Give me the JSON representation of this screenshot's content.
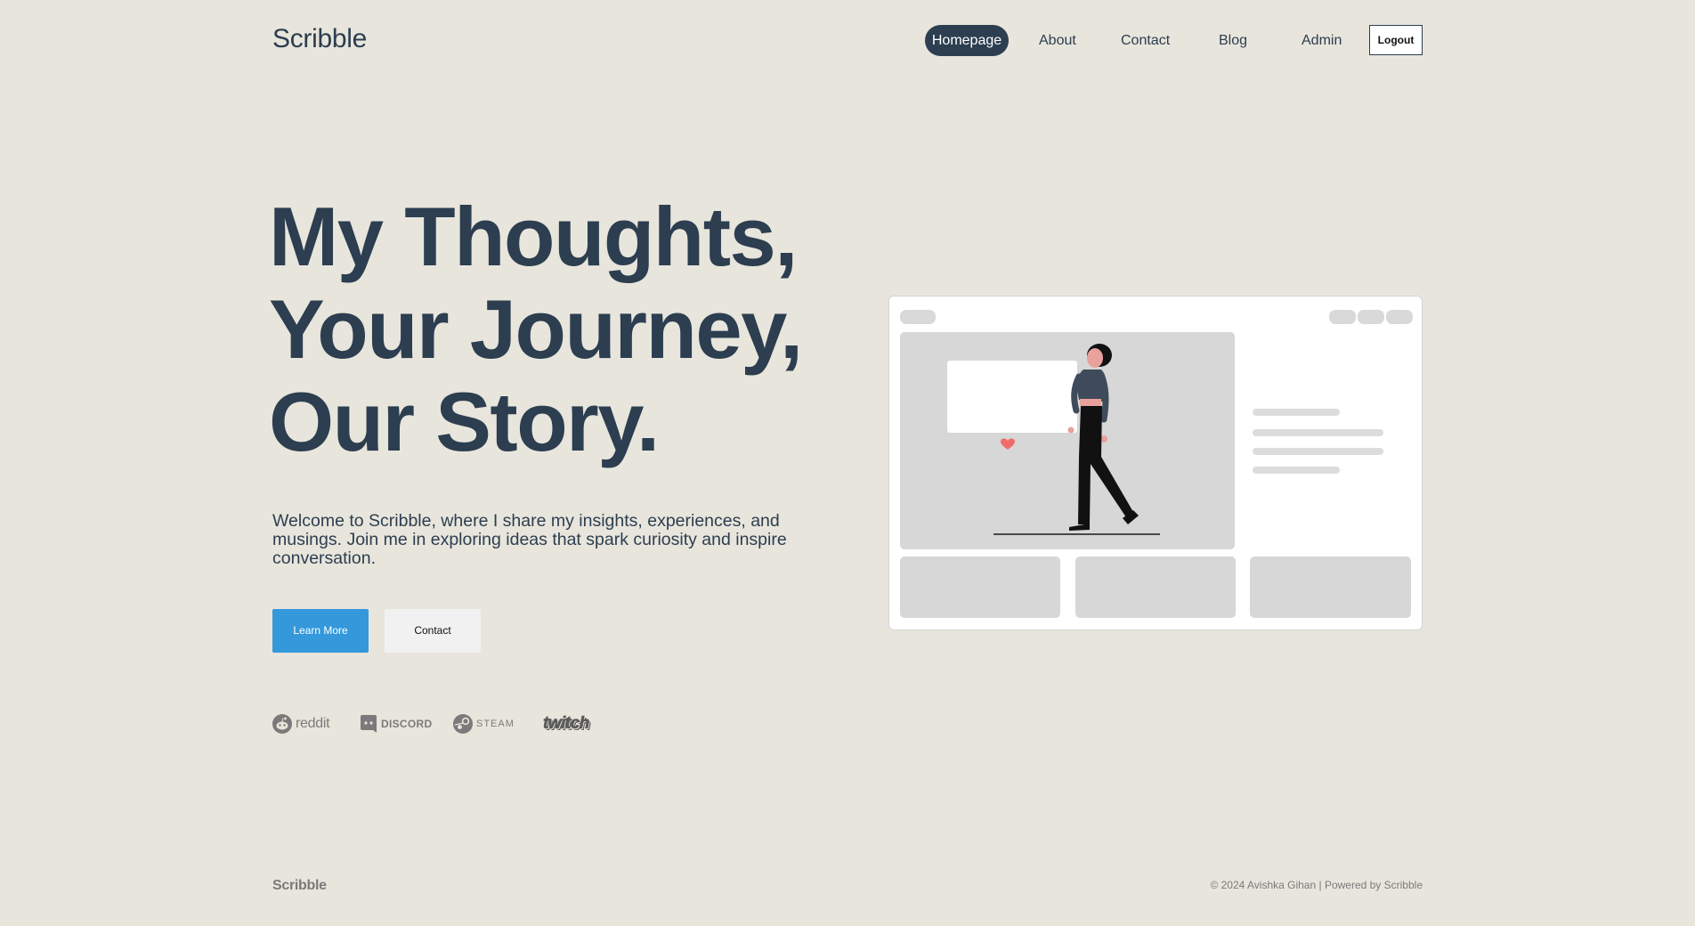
{
  "header": {
    "brand": "Scribble",
    "nav": [
      {
        "label": "Homepage",
        "active": true
      },
      {
        "label": "About"
      },
      {
        "label": "Contact"
      },
      {
        "label": "Blog"
      },
      {
        "label": "Admin"
      }
    ],
    "logout_label": "Logout"
  },
  "hero": {
    "title_lines": [
      "My Thoughts,",
      "Your Journey,",
      "Our Story."
    ],
    "description": "Welcome to Scribble, where I share my insights, experiences, and musings. Join me in exploring ideas that spark curiosity and inspire conversation.",
    "primary_button": "Learn More",
    "secondary_button": "Contact"
  },
  "logos": [
    {
      "name": "reddit",
      "icon": "reddit-icon"
    },
    {
      "name": "DISCORD",
      "icon": "discord-icon"
    },
    {
      "name": "STEAM",
      "icon": "steam-icon"
    },
    {
      "name": "twitch",
      "icon": "twitch-icon"
    }
  ],
  "footer": {
    "brand": "Scribble",
    "copyright": "© 2024 Avishka Gihan | Powered by Scribble"
  },
  "colors": {
    "background": "#e8e5dc",
    "primary_text": "#2c3e50",
    "accent": "#3498db",
    "muted": "#7a7a7a",
    "heart": "#f16b6b"
  }
}
